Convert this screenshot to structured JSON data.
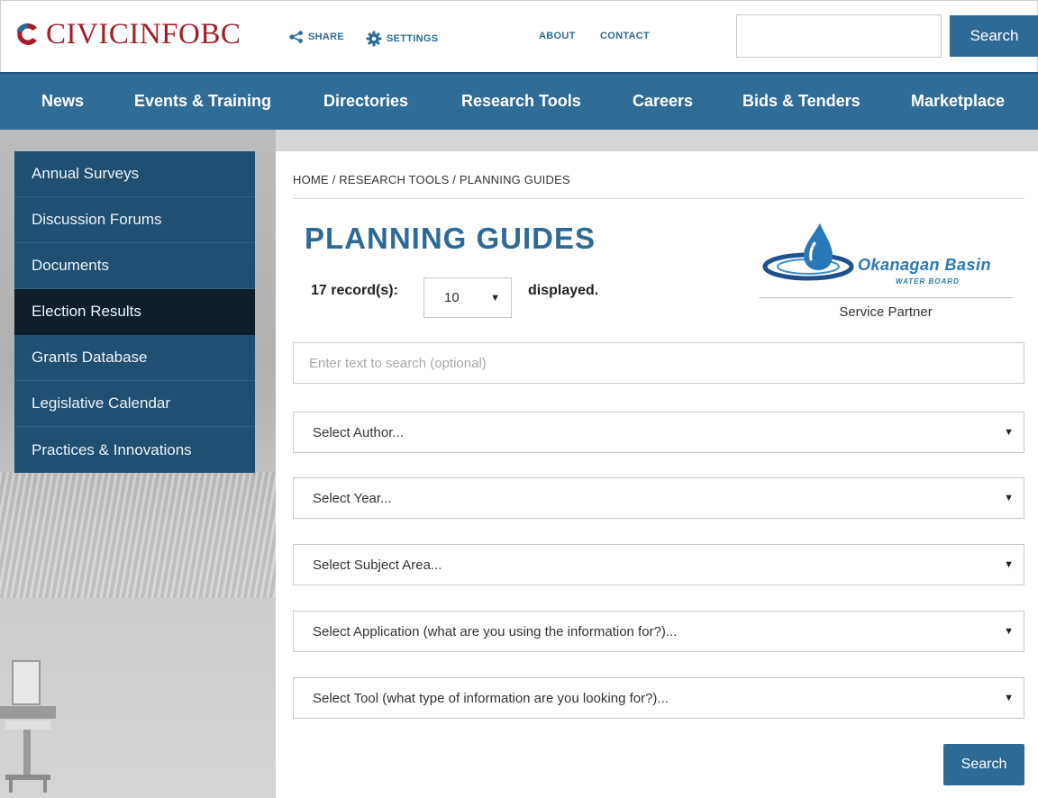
{
  "header": {
    "logo_text": "CIVICINFOBC",
    "share_label": "SHARE",
    "settings_label": "SETTINGS",
    "about_label": "ABOUT",
    "contact_label": "CONTACT",
    "search_value": "",
    "search_button": "Search"
  },
  "nav": {
    "items": [
      "News",
      "Events & Training",
      "Directories",
      "Research Tools",
      "Careers",
      "Bids & Tenders",
      "Marketplace"
    ]
  },
  "sidebar": {
    "items": [
      "Annual Surveys",
      "Discussion Forums",
      "Documents",
      "Election Results",
      "Grants Database",
      "Legislative Calendar",
      "Practices & Innovations"
    ],
    "active": "Election Results"
  },
  "main": {
    "breadcrumb": "HOME / RESEARCH TOOLS / PLANNING GUIDES",
    "title": "PLANNING GUIDES",
    "records_label": "17 record(s):",
    "records_per_page": "10",
    "displayed_label": "displayed.",
    "partner": {
      "name": "Okanagan Basin",
      "sub": "WATER BOARD",
      "label": "Service Partner"
    },
    "search_placeholder": "Enter text to search (optional)",
    "selects": {
      "author": "Select Author...",
      "year": "Select Year...",
      "subject": "Select Subject Area...",
      "application": "Select Application (what are you using the information for?)...",
      "tool": "Select Tool (what type of information are you looking for?)..."
    },
    "submit_label": "Search"
  },
  "colors": {
    "brand_red": "#a31e2a",
    "primary_blue": "#2d6a96",
    "nav_blue": "#2f6d98",
    "sidebar_blue": "#1f4f71",
    "sidebar_active": "#0f1e2b"
  }
}
